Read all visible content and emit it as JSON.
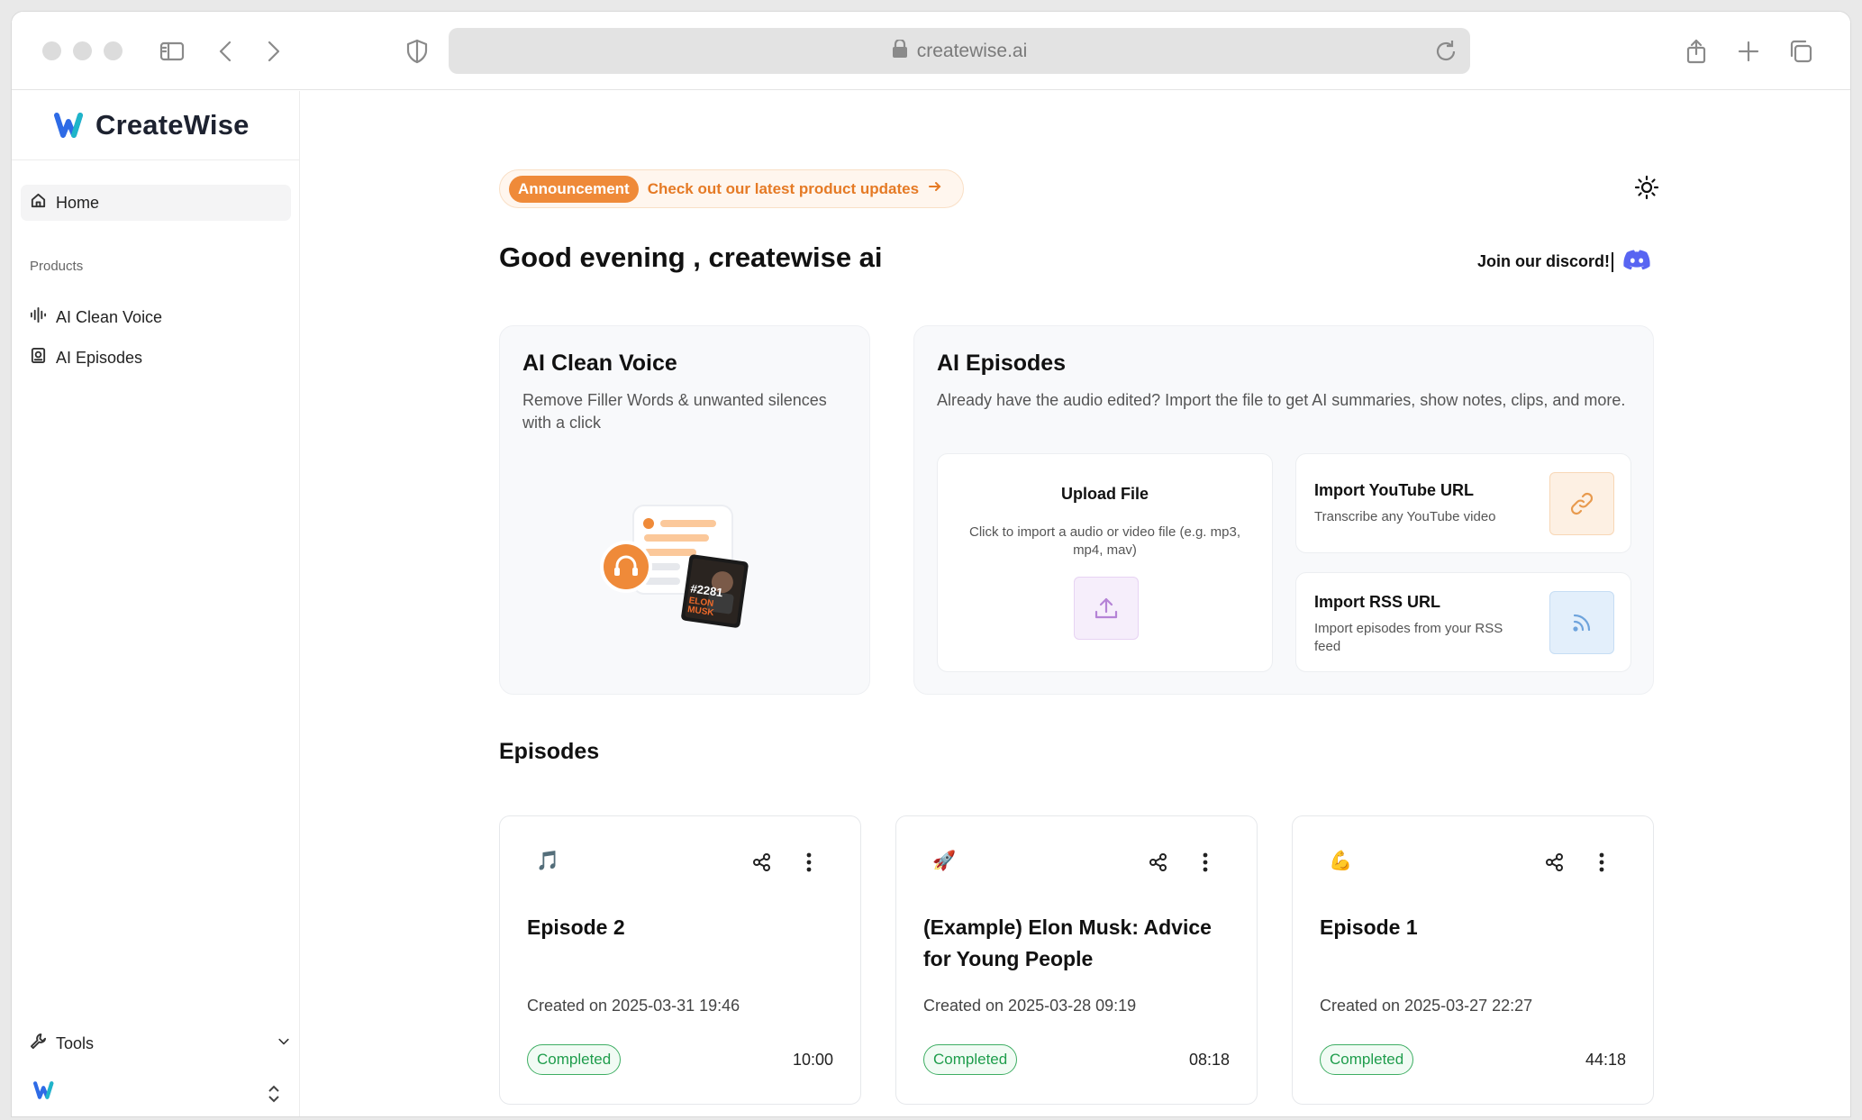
{
  "browser": {
    "url": "createwise.ai"
  },
  "brand": {
    "name": "CreateWise",
    "accent": "#ef8a39",
    "logo_blue": "#2e6be6",
    "logo_teal": "#1fb5c9"
  },
  "sidebar": {
    "home_label": "Home",
    "section_label": "Products",
    "items": [
      {
        "label": "AI Clean Voice",
        "icon": "waveform-icon"
      },
      {
        "label": "AI Episodes",
        "icon": "episodes-icon"
      }
    ],
    "tools_label": "Tools"
  },
  "header": {
    "announcement_badge": "Announcement",
    "announcement_link": "Check out our latest product updates",
    "greeting": "Good evening , createwise ai",
    "discord_label": "Join our discord!"
  },
  "cards": {
    "clean_voice": {
      "title": "AI Clean Voice",
      "description": "Remove Filler Words & unwanted silences with a click",
      "thumb_text": "#2281 ELON MUSK"
    },
    "episodes": {
      "title": "AI Episodes",
      "description": "Already have the audio edited? Import the file to get AI summaries, show notes, clips, and more.",
      "upload_title": "Upload File",
      "upload_desc": "Click to import a audio or video file (e.g. mp3, mp4, mav)",
      "youtube_title": "Import YouTube URL",
      "youtube_desc": "Transcribe any YouTube video",
      "rss_title": "Import RSS URL",
      "rss_desc": "Import episodes from your RSS feed"
    }
  },
  "episodes_section": {
    "title": "Episodes",
    "items": [
      {
        "emoji": "🎵",
        "title": "Episode 2",
        "created": "Created on 2025-03-31 19:46",
        "status": "Completed",
        "duration": "10:00"
      },
      {
        "emoji": "🚀",
        "title": "(Example) Elon Musk: Advice for Young People",
        "created": "Created on 2025-03-28 09:19",
        "status": "Completed",
        "duration": "08:18"
      },
      {
        "emoji": "💪",
        "title": "Episode 1",
        "created": "Created on 2025-03-27 22:27",
        "status": "Completed",
        "duration": "44:18"
      }
    ]
  }
}
